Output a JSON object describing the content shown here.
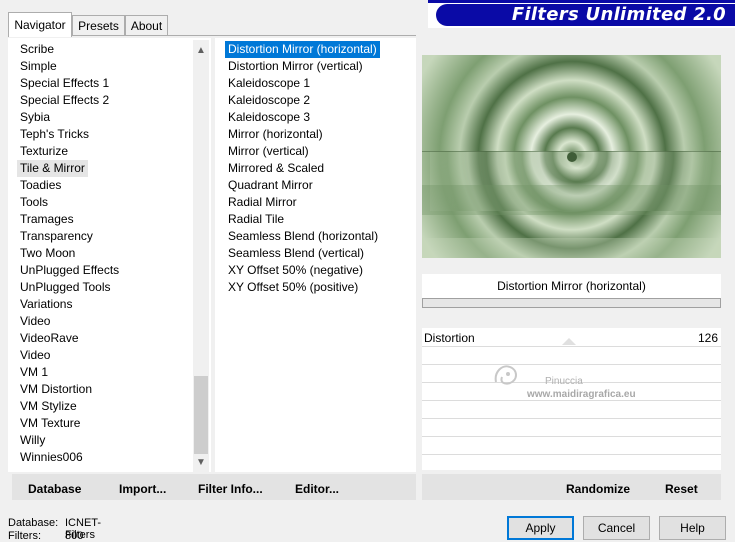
{
  "tabs": [
    "Navigator",
    "Presets",
    "About"
  ],
  "banner_title": "Filters Unlimited 2.0",
  "categories": [
    "Scribe",
    "Simple",
    "Special Effects 1",
    "Special Effects 2",
    "Sybia",
    "Teph's Tricks",
    "Texturize",
    "Tile & Mirror",
    "Toadies",
    "Tools",
    "Tramages",
    "Transparency",
    "Two Moon",
    "UnPlugged Effects",
    "UnPlugged Tools",
    "Variations",
    "Video",
    "VideoRave",
    "Video",
    "VM 1",
    "VM Distortion",
    "VM Stylize",
    "VM Texture",
    "Willy",
    "Winnies006"
  ],
  "selected_category": "Tile & Mirror",
  "filters": [
    "Distortion Mirror (horizontal)",
    "Distortion Mirror (vertical)",
    "Kaleidoscope 1",
    "Kaleidoscope 2",
    "Kaleidoscope 3",
    "Mirror (horizontal)",
    "Mirror (vertical)",
    "Mirrored & Scaled",
    "Quadrant Mirror",
    "Radial Mirror",
    "Radial Tile",
    "Seamless Blend (horizontal)",
    "Seamless Blend (vertical)",
    "XY Offset 50% (negative)",
    "XY Offset 50% (positive)"
  ],
  "selected_filter": "Distortion Mirror (horizontal)",
  "filter_name_display": "Distortion Mirror (horizontal)",
  "parameter": {
    "label": "Distortion",
    "value": "126"
  },
  "watermark": {
    "line1": "Pinuccia",
    "line2": "www.maidiragrafica.eu"
  },
  "left_buttons": {
    "database": "Database",
    "import": "Import...",
    "filter_info": "Filter Info...",
    "editor": "Editor..."
  },
  "right_buttons": {
    "randomize": "Randomize",
    "reset": "Reset"
  },
  "dialog_buttons": {
    "apply": "Apply",
    "cancel": "Cancel",
    "help": "Help"
  },
  "status": {
    "database_label": "Database:",
    "database_value": "ICNET-Filters",
    "filters_label": "Filters:",
    "filters_value": "800"
  },
  "colors": {
    "banner": "#0a0aa6",
    "selection": "#0078d7",
    "preview_green": "#8aa57e"
  }
}
